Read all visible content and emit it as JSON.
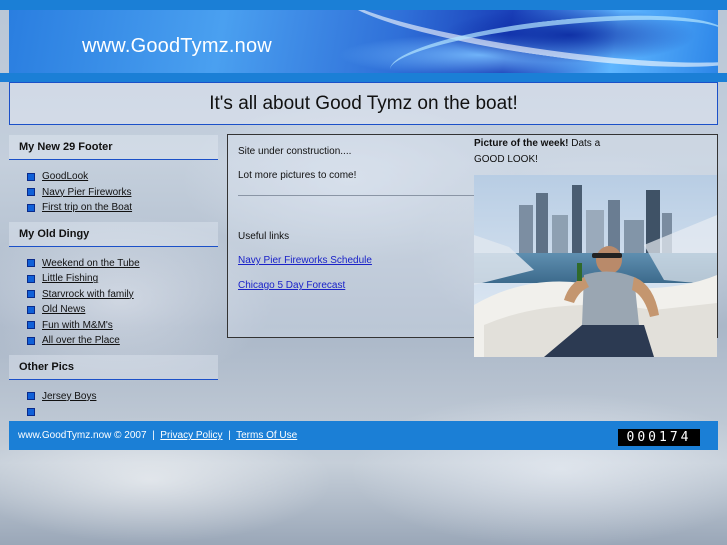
{
  "header": {
    "site_title": "www.GoodTymz.now",
    "tagline": "It's all about Good Tymz on the boat!"
  },
  "sidebar": {
    "sections": [
      {
        "title": "My New 29 Footer",
        "items": [
          "GoodLook",
          "Navy Pier Fireworks",
          "First trip on the Boat"
        ]
      },
      {
        "title": "My Old Dingy",
        "items": [
          "Weekend on the Tube",
          "Little Fishing",
          "Starvrock with family",
          "Old News",
          "Fun with M&M's",
          "All over the Place"
        ]
      },
      {
        "title": "Other Pics",
        "items": [
          "Jersey Boys",
          ""
        ]
      }
    ]
  },
  "main": {
    "line1": "Site under construction....",
    "line2": "Lot more pictures to come!",
    "useful_links_label": "Useful links",
    "link1": "Navy Pier Fireworks Schedule",
    "link2": "Chicago 5 Day Forecast",
    "potw_label": "Picture of the week!",
    "potw_text": " Dats a GOOD LOOK!"
  },
  "footer": {
    "copyright": "www.GoodTymz.now © 2007",
    "sep": "|",
    "privacy": "Privacy Policy",
    "terms": "Terms Of Use",
    "counter": "000174"
  },
  "colors": {
    "accent": "#1b7fd6",
    "link": "#1a22c8",
    "bullet": "#1060d8"
  }
}
